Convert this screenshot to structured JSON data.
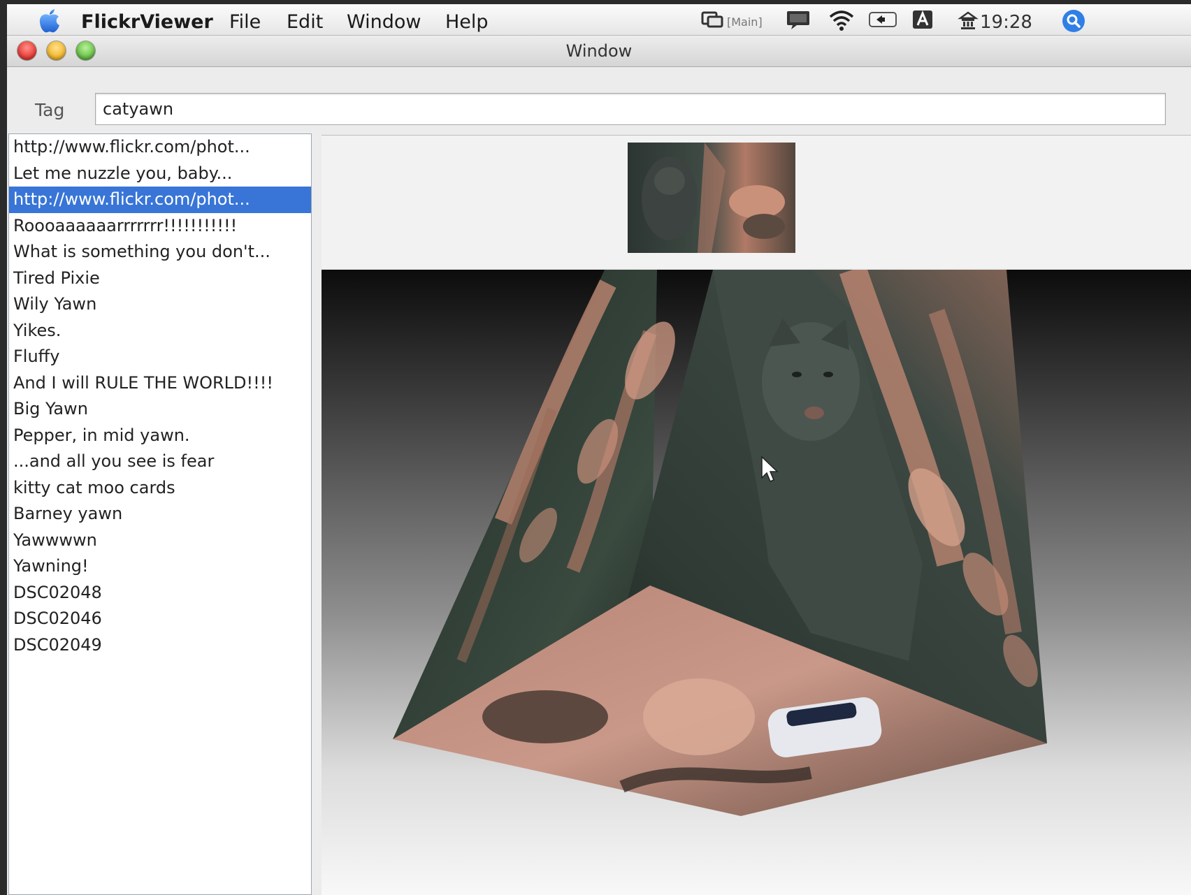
{
  "menubar": {
    "app_name": "FlickrViewer",
    "menus": [
      "File",
      "Edit",
      "Window",
      "Help"
    ],
    "display_label": "[Main]",
    "clock": "19:28",
    "icons": [
      "apple-icon",
      "display-icon",
      "chat-icon",
      "wifi-icon",
      "volume-icon",
      "input-menu-icon",
      "lock-icon",
      "spotlight-icon"
    ]
  },
  "window": {
    "title": "Window",
    "tag_label": "Tag",
    "tag_value": "catyawn"
  },
  "photo_list": {
    "selected_index": 2,
    "items": [
      "http://www.flickr.com/phot...",
      "Let me nuzzle you, baby...",
      "http://www.flickr.com/phot...",
      "Roooaaaaaarrrrrrr!!!!!!!!!!!",
      "What is something you don't...",
      "Tired Pixie",
      "Wily Yawn",
      "Yikes.",
      "Fluffy",
      "And I will RULE THE WORLD!!!!",
      "Big Yawn",
      "Pepper, in mid yawn.",
      "...and all you see is fear",
      "kitty cat moo cards",
      "Barney yawn",
      "Yawwwwn",
      "Yawning!",
      "DSC02048",
      "DSC02046",
      "DSC02049"
    ]
  },
  "colors": {
    "selection": "#3875d7",
    "close": "#e9403a",
    "minimize": "#f2b933",
    "zoom": "#6cc24a"
  }
}
